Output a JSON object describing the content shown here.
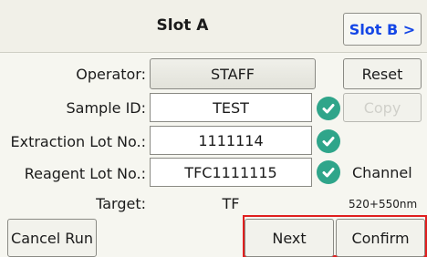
{
  "header": {
    "title": "Slot A",
    "slot_b_label": "Slot B >"
  },
  "form": {
    "operator": {
      "label": "Operator:",
      "value": "STAFF"
    },
    "sample_id": {
      "label": "Sample ID:",
      "value": "TEST"
    },
    "extraction_lot": {
      "label": "Extraction Lot No.:",
      "value": "1111114"
    },
    "reagent_lot": {
      "label": "Reagent Lot No.:",
      "value": "TFC1111115"
    },
    "target": {
      "label": "Target:",
      "value": "TF"
    }
  },
  "side": {
    "reset_label": "Reset",
    "copy_label": "Copy",
    "channel_label": "Channel",
    "channel_value": "520+550nm"
  },
  "footer": {
    "cancel_label": "Cancel Run",
    "next_label": "Next",
    "confirm_label": "Confirm"
  },
  "colors": {
    "accent_blue": "#1446e6",
    "check_green": "#2fa58a",
    "highlight_red": "#e01f1f"
  },
  "icons": {
    "check": "check-circle-icon"
  }
}
